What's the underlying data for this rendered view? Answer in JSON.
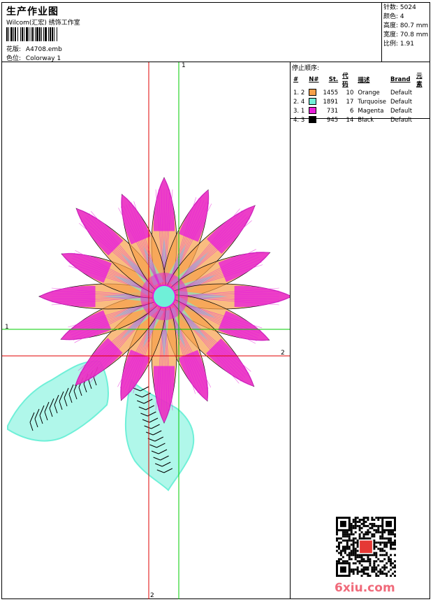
{
  "header": {
    "title": "生产作业图",
    "subtitle": "Wilcom(汇宏) 绣饰工作室",
    "design_label": "花版:",
    "design_value": "A4708.emb",
    "colorway_label": "色位:",
    "colorway_value": "Colorway 1"
  },
  "stats": {
    "stitches": "针数: 5024",
    "colors": "颜色: 4",
    "height": "高度: 80.7 mm",
    "width": "宽度: 70.8 mm",
    "scale": "比例: 1.91"
  },
  "stop_sequence": {
    "caption": "停止顺序:",
    "headers": [
      "#",
      "N#",
      "St.",
      "代码",
      "描述",
      "Brand",
      "元素"
    ],
    "rows": [
      {
        "num": "1.",
        "needle": "2",
        "color": "#F7A04A",
        "stitches": "1455",
        "code": "10",
        "desc": "Orange",
        "brand": "Default",
        "element": ""
      },
      {
        "num": "2.",
        "needle": "4",
        "color": "#6FF0D8",
        "stitches": "1891",
        "code": "17",
        "desc": "Turquoise",
        "brand": "Default",
        "element": ""
      },
      {
        "num": "3.",
        "needle": "1",
        "color": "#E81FD8",
        "stitches": "731",
        "code": "6",
        "desc": "Magenta",
        "brand": "Default",
        "element": ""
      },
      {
        "num": "4.",
        "needle": "3",
        "color": "#000000",
        "stitches": "945",
        "code": "14",
        "desc": "Black",
        "brand": "Default",
        "element": ""
      }
    ]
  },
  "axes": {
    "green_v": "1",
    "green_h": "1",
    "red_h": "2",
    "red_v": "2"
  },
  "colors": {
    "orange": "#F7A04A",
    "turquoise": "#6FF0D8",
    "magenta": "#E81FD8",
    "black": "#000000",
    "green_axis": "#00CC00",
    "red_axis": "#E00000"
  },
  "watermark": "6xiu.com"
}
